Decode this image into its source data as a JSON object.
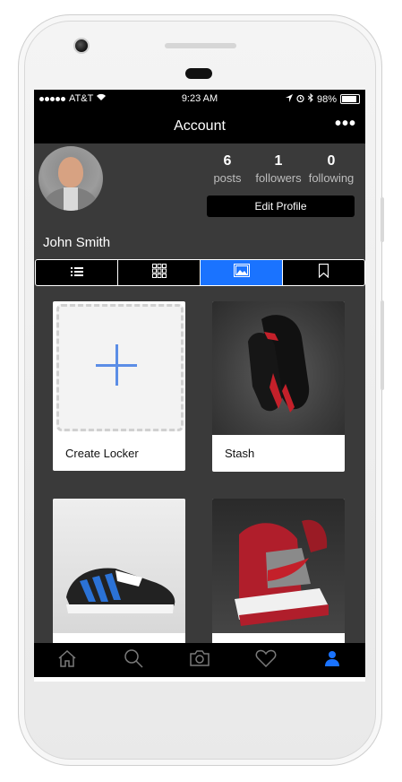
{
  "status_bar": {
    "carrier": "AT&T",
    "time": "9:23 AM",
    "battery": "98%"
  },
  "nav": {
    "title": "Account",
    "more_icon": "more-dots-icon"
  },
  "profile": {
    "posts_count": "6",
    "posts_label": "posts",
    "followers_count": "1",
    "followers_label": "followers",
    "following_count": "0",
    "following_label": "following",
    "edit_button": "Edit Profile",
    "name": "John Smith"
  },
  "view_tabs": [
    {
      "icon": "list-icon",
      "active": false
    },
    {
      "icon": "grid-icon",
      "active": false
    },
    {
      "icon": "image-icon",
      "active": true
    },
    {
      "icon": "bookmark-icon",
      "active": false
    }
  ],
  "lockers": [
    {
      "label": "Create Locker",
      "kind": "create"
    },
    {
      "label": "Stash",
      "kind": "photo"
    },
    {
      "label": "",
      "kind": "photo"
    },
    {
      "label": "",
      "kind": "photo"
    }
  ],
  "tab_bar": [
    {
      "icon": "home-icon",
      "active": false
    },
    {
      "icon": "search-icon",
      "active": false
    },
    {
      "icon": "camera-icon",
      "active": false
    },
    {
      "icon": "heart-icon",
      "active": false
    },
    {
      "icon": "profile-icon",
      "active": true
    }
  ],
  "colors": {
    "accent": "#1a73ff",
    "background": "#3a3a3a",
    "bar": "#000000",
    "plus": "#5b8de6"
  }
}
